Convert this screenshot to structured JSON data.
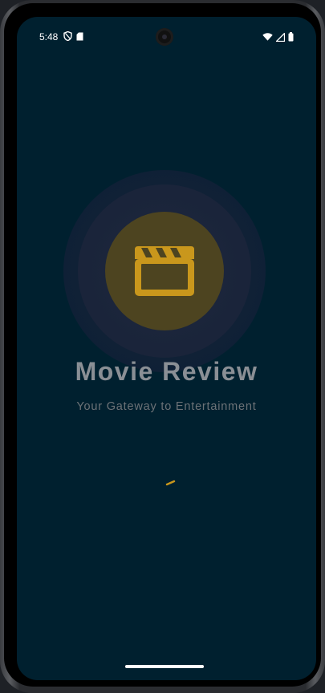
{
  "status_bar": {
    "time": "5:48",
    "left_icons": [
      "shield-icon",
      "sim-card-icon"
    ],
    "right_icons": [
      "wifi-icon",
      "cellular-signal-icon",
      "battery-icon"
    ]
  },
  "splash": {
    "title": "Movie Review",
    "subtitle": "Your Gateway to Entertainment",
    "logo_icon": "movie-clapperboard-icon",
    "accent_color": "#c9971c",
    "background_color": "#00202f",
    "loading": true
  }
}
